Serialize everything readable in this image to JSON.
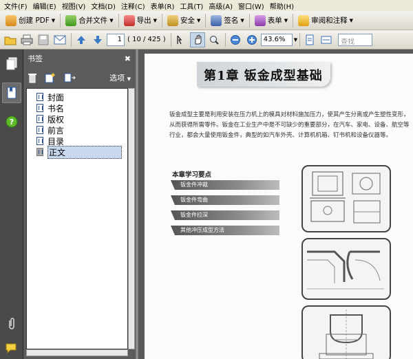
{
  "menu": [
    "文件(F)",
    "编辑(E)",
    "视图(V)",
    "文档(D)",
    "注释(C)",
    "表单(R)",
    "工具(T)",
    "高级(A)",
    "窗口(W)",
    "帮助(H)"
  ],
  "toolbar1": {
    "create_pdf": "创建 PDF",
    "combine": "合并文件",
    "export": "导出",
    "security": "安全",
    "sign": "签名",
    "forms": "表单",
    "review": "审阅和注释"
  },
  "toolbar2": {
    "current_page": "1",
    "page_total": "( 10 / 425 )",
    "zoom": "43.6%",
    "search_placeholder": "查找"
  },
  "panel": {
    "title": "书签",
    "options_label": "选项",
    "bookmarks": [
      "封面",
      "书名",
      "版权",
      "前言",
      "目录",
      "正文"
    ]
  },
  "document": {
    "chapter_title": "第1章   钣金成型基础",
    "intro": "钣金成型主要是利用安装在压力机上的模具对材料施加压力，使其产生分离或产生塑性变形，从而获得所需零件。钣金在工业生产中是不可缺少的重要部分，在汽车、家电、设备、航空等行业，都会大量使用钣金件，典型的如汽车外壳、计算机机箱、钉书机和设备仪器等。",
    "learning_heading": "本章学习要点",
    "learning_points": [
      "钣金件冲裁",
      "钣金件弯曲",
      "钣金件拉深",
      "其他冲压成型方法"
    ]
  },
  "colors": {
    "panel_bg": "#5c5c5c",
    "viewer_bg": "#5a5a5a",
    "selection": "#c8d8ef"
  }
}
